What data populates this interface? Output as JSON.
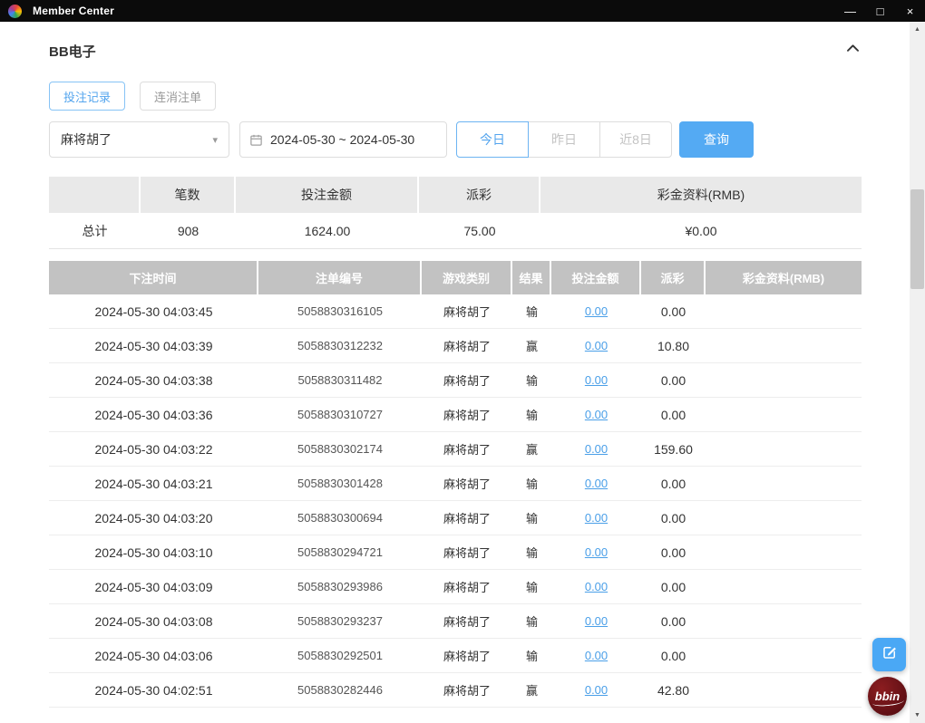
{
  "window": {
    "title": "Member Center",
    "controls": {
      "minimize": "—",
      "maximize": "□",
      "close": "×"
    }
  },
  "page": {
    "title": "BB电子"
  },
  "tabs": [
    {
      "label": "投注记录",
      "active": true
    },
    {
      "label": "连消注单",
      "active": false
    }
  ],
  "filters": {
    "game_select": {
      "value": "麻将胡了",
      "chevron": "▾"
    },
    "date_range": "2024-05-30 ~ 2024-05-30",
    "quick_ranges": [
      {
        "label": "今日",
        "active": true
      },
      {
        "label": "昨日",
        "active": false
      },
      {
        "label": "近8日",
        "active": false
      }
    ],
    "search_button": "查询"
  },
  "summary": {
    "headers": [
      "",
      "笔数",
      "投注金额",
      "派彩",
      "彩金资料(RMB)"
    ],
    "total": {
      "label": "总计",
      "count": "908",
      "bet_amount": "1624.00",
      "payout": "75.00",
      "bonus": "¥0.00"
    }
  },
  "table": {
    "headers": [
      "下注时间",
      "注单编号",
      "游戏类别",
      "结果",
      "投注金额",
      "派彩",
      "彩金资料(RMB)"
    ],
    "rows": [
      {
        "time": "2024-05-30 04:03:45",
        "order": "5058830316105",
        "game": "麻将胡了",
        "result": "输",
        "bet": "0.00",
        "payout": "0.00",
        "bonus": ""
      },
      {
        "time": "2024-05-30 04:03:39",
        "order": "5058830312232",
        "game": "麻将胡了",
        "result": "赢",
        "bet": "0.00",
        "payout": "10.80",
        "bonus": ""
      },
      {
        "time": "2024-05-30 04:03:38",
        "order": "5058830311482",
        "game": "麻将胡了",
        "result": "输",
        "bet": "0.00",
        "payout": "0.00",
        "bonus": ""
      },
      {
        "time": "2024-05-30 04:03:36",
        "order": "5058830310727",
        "game": "麻将胡了",
        "result": "输",
        "bet": "0.00",
        "payout": "0.00",
        "bonus": ""
      },
      {
        "time": "2024-05-30 04:03:22",
        "order": "5058830302174",
        "game": "麻将胡了",
        "result": "赢",
        "bet": "0.00",
        "payout": "159.60",
        "bonus": ""
      },
      {
        "time": "2024-05-30 04:03:21",
        "order": "5058830301428",
        "game": "麻将胡了",
        "result": "输",
        "bet": "0.00",
        "payout": "0.00",
        "bonus": ""
      },
      {
        "time": "2024-05-30 04:03:20",
        "order": "5058830300694",
        "game": "麻将胡了",
        "result": "输",
        "bet": "0.00",
        "payout": "0.00",
        "bonus": ""
      },
      {
        "time": "2024-05-30 04:03:10",
        "order": "5058830294721",
        "game": "麻将胡了",
        "result": "输",
        "bet": "0.00",
        "payout": "0.00",
        "bonus": ""
      },
      {
        "time": "2024-05-30 04:03:09",
        "order": "5058830293986",
        "game": "麻将胡了",
        "result": "输",
        "bet": "0.00",
        "payout": "0.00",
        "bonus": ""
      },
      {
        "time": "2024-05-30 04:03:08",
        "order": "5058830293237",
        "game": "麻将胡了",
        "result": "输",
        "bet": "0.00",
        "payout": "0.00",
        "bonus": ""
      },
      {
        "time": "2024-05-30 04:03:06",
        "order": "5058830292501",
        "game": "麻将胡了",
        "result": "输",
        "bet": "0.00",
        "payout": "0.00",
        "bonus": ""
      },
      {
        "time": "2024-05-30 04:02:51",
        "order": "5058830282446",
        "game": "麻将胡了",
        "result": "赢",
        "bet": "0.00",
        "payout": "42.80",
        "bonus": ""
      }
    ]
  },
  "scrollbar": {
    "up": "▲",
    "down": "▼"
  },
  "fab": {
    "bbin_label": "bbin"
  },
  "colors": {
    "accent_blue": "#54aaf3",
    "link_blue": "#4a9fe8",
    "table_header_gray": "#c2c2c2",
    "summary_header_gray": "#e9e9e9",
    "titlebar_black": "#0b0b0b",
    "bbin_red": "#6b1317"
  }
}
